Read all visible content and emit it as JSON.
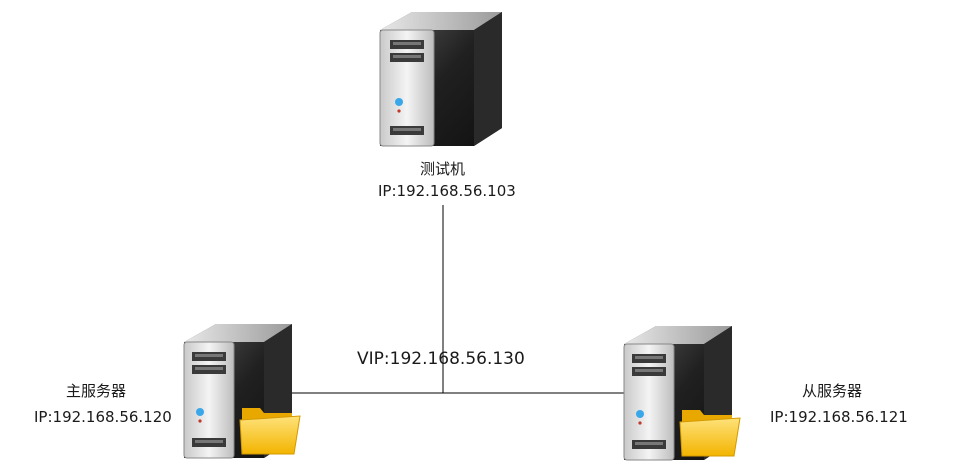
{
  "nodes": {
    "test": {
      "name": "测试机",
      "ip": "IP:192.168.56.103",
      "icon": "server-icon"
    },
    "master": {
      "name": "主服务器",
      "ip": "IP:192.168.56.120",
      "icon": "file-server-icon"
    },
    "slave": {
      "name": "从服务器",
      "ip": "IP:192.168.56.121",
      "icon": "file-server-icon"
    }
  },
  "vip": "VIP:192.168.56.130",
  "colors": {
    "line": "#000000",
    "folder": "#f5c21b",
    "server_body": "#2b2b2b"
  }
}
